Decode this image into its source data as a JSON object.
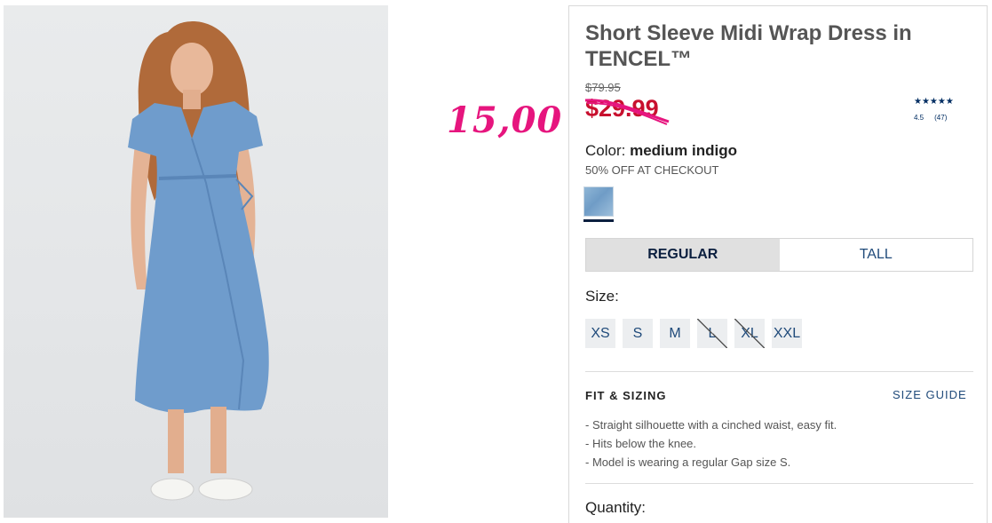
{
  "product": {
    "title": "Short Sleeve Midi Wrap Dress in TENCEL™",
    "original_price": "$79.95",
    "sale_price": "$29.99",
    "annotated_price": "15,00",
    "rating": {
      "stars": "★★★★★",
      "score": "4.5",
      "count": "(47)"
    },
    "color": {
      "label": "Color:",
      "value": "medium indigo",
      "swatch_color": "#7ba6cf"
    },
    "promo": "50% OFF AT CHECKOUT",
    "fit_tabs": [
      {
        "label": "REGULAR",
        "selected": true
      },
      {
        "label": "TALL",
        "selected": false
      }
    ],
    "size_label": "Size:",
    "sizes": [
      {
        "label": "XS",
        "available": true
      },
      {
        "label": "S",
        "available": true
      },
      {
        "label": "M",
        "available": true
      },
      {
        "label": "L",
        "available": false
      },
      {
        "label": "XL",
        "available": false
      },
      {
        "label": "XXL",
        "available": true
      }
    ],
    "fit_section": {
      "title": "FIT & SIZING",
      "size_guide": "SIZE GUIDE",
      "bullets": [
        "Straight silhouette with a cinched waist, easy fit.",
        "Hits below the knee.",
        "Model is wearing a regular Gap size S."
      ]
    },
    "quantity_label": "Quantity:"
  },
  "colors": {
    "sale_red": "#c8102e",
    "annotation_pink": "#e6157e",
    "navy": "#0b1f3f",
    "link_blue": "#1f4a7a"
  }
}
